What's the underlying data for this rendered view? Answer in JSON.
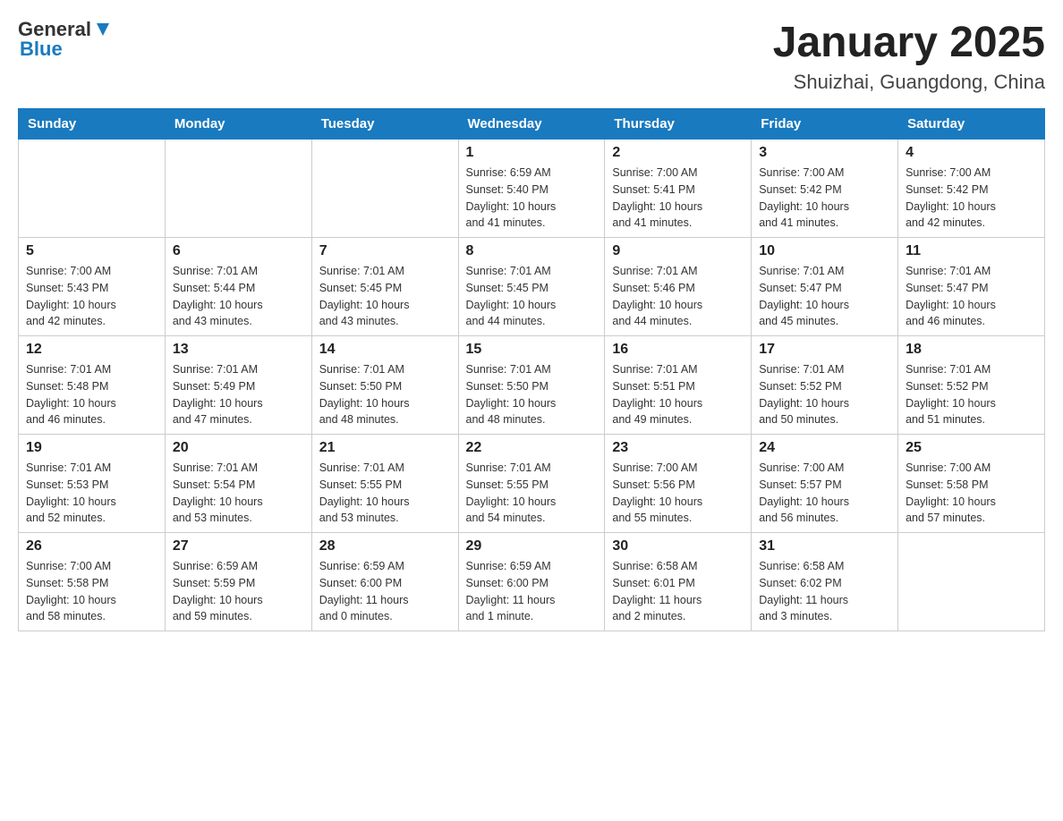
{
  "header": {
    "logo_general": "General",
    "logo_blue": "Blue",
    "title": "January 2025",
    "subtitle": "Shuizhai, Guangdong, China"
  },
  "weekdays": [
    "Sunday",
    "Monday",
    "Tuesday",
    "Wednesday",
    "Thursday",
    "Friday",
    "Saturday"
  ],
  "weeks": [
    [
      {
        "day": "",
        "info": ""
      },
      {
        "day": "",
        "info": ""
      },
      {
        "day": "",
        "info": ""
      },
      {
        "day": "1",
        "info": "Sunrise: 6:59 AM\nSunset: 5:40 PM\nDaylight: 10 hours\nand 41 minutes."
      },
      {
        "day": "2",
        "info": "Sunrise: 7:00 AM\nSunset: 5:41 PM\nDaylight: 10 hours\nand 41 minutes."
      },
      {
        "day": "3",
        "info": "Sunrise: 7:00 AM\nSunset: 5:42 PM\nDaylight: 10 hours\nand 41 minutes."
      },
      {
        "day": "4",
        "info": "Sunrise: 7:00 AM\nSunset: 5:42 PM\nDaylight: 10 hours\nand 42 minutes."
      }
    ],
    [
      {
        "day": "5",
        "info": "Sunrise: 7:00 AM\nSunset: 5:43 PM\nDaylight: 10 hours\nand 42 minutes."
      },
      {
        "day": "6",
        "info": "Sunrise: 7:01 AM\nSunset: 5:44 PM\nDaylight: 10 hours\nand 43 minutes."
      },
      {
        "day": "7",
        "info": "Sunrise: 7:01 AM\nSunset: 5:45 PM\nDaylight: 10 hours\nand 43 minutes."
      },
      {
        "day": "8",
        "info": "Sunrise: 7:01 AM\nSunset: 5:45 PM\nDaylight: 10 hours\nand 44 minutes."
      },
      {
        "day": "9",
        "info": "Sunrise: 7:01 AM\nSunset: 5:46 PM\nDaylight: 10 hours\nand 44 minutes."
      },
      {
        "day": "10",
        "info": "Sunrise: 7:01 AM\nSunset: 5:47 PM\nDaylight: 10 hours\nand 45 minutes."
      },
      {
        "day": "11",
        "info": "Sunrise: 7:01 AM\nSunset: 5:47 PM\nDaylight: 10 hours\nand 46 minutes."
      }
    ],
    [
      {
        "day": "12",
        "info": "Sunrise: 7:01 AM\nSunset: 5:48 PM\nDaylight: 10 hours\nand 46 minutes."
      },
      {
        "day": "13",
        "info": "Sunrise: 7:01 AM\nSunset: 5:49 PM\nDaylight: 10 hours\nand 47 minutes."
      },
      {
        "day": "14",
        "info": "Sunrise: 7:01 AM\nSunset: 5:50 PM\nDaylight: 10 hours\nand 48 minutes."
      },
      {
        "day": "15",
        "info": "Sunrise: 7:01 AM\nSunset: 5:50 PM\nDaylight: 10 hours\nand 48 minutes."
      },
      {
        "day": "16",
        "info": "Sunrise: 7:01 AM\nSunset: 5:51 PM\nDaylight: 10 hours\nand 49 minutes."
      },
      {
        "day": "17",
        "info": "Sunrise: 7:01 AM\nSunset: 5:52 PM\nDaylight: 10 hours\nand 50 minutes."
      },
      {
        "day": "18",
        "info": "Sunrise: 7:01 AM\nSunset: 5:52 PM\nDaylight: 10 hours\nand 51 minutes."
      }
    ],
    [
      {
        "day": "19",
        "info": "Sunrise: 7:01 AM\nSunset: 5:53 PM\nDaylight: 10 hours\nand 52 minutes."
      },
      {
        "day": "20",
        "info": "Sunrise: 7:01 AM\nSunset: 5:54 PM\nDaylight: 10 hours\nand 53 minutes."
      },
      {
        "day": "21",
        "info": "Sunrise: 7:01 AM\nSunset: 5:55 PM\nDaylight: 10 hours\nand 53 minutes."
      },
      {
        "day": "22",
        "info": "Sunrise: 7:01 AM\nSunset: 5:55 PM\nDaylight: 10 hours\nand 54 minutes."
      },
      {
        "day": "23",
        "info": "Sunrise: 7:00 AM\nSunset: 5:56 PM\nDaylight: 10 hours\nand 55 minutes."
      },
      {
        "day": "24",
        "info": "Sunrise: 7:00 AM\nSunset: 5:57 PM\nDaylight: 10 hours\nand 56 minutes."
      },
      {
        "day": "25",
        "info": "Sunrise: 7:00 AM\nSunset: 5:58 PM\nDaylight: 10 hours\nand 57 minutes."
      }
    ],
    [
      {
        "day": "26",
        "info": "Sunrise: 7:00 AM\nSunset: 5:58 PM\nDaylight: 10 hours\nand 58 minutes."
      },
      {
        "day": "27",
        "info": "Sunrise: 6:59 AM\nSunset: 5:59 PM\nDaylight: 10 hours\nand 59 minutes."
      },
      {
        "day": "28",
        "info": "Sunrise: 6:59 AM\nSunset: 6:00 PM\nDaylight: 11 hours\nand 0 minutes."
      },
      {
        "day": "29",
        "info": "Sunrise: 6:59 AM\nSunset: 6:00 PM\nDaylight: 11 hours\nand 1 minute."
      },
      {
        "day": "30",
        "info": "Sunrise: 6:58 AM\nSunset: 6:01 PM\nDaylight: 11 hours\nand 2 minutes."
      },
      {
        "day": "31",
        "info": "Sunrise: 6:58 AM\nSunset: 6:02 PM\nDaylight: 11 hours\nand 3 minutes."
      },
      {
        "day": "",
        "info": ""
      }
    ]
  ]
}
